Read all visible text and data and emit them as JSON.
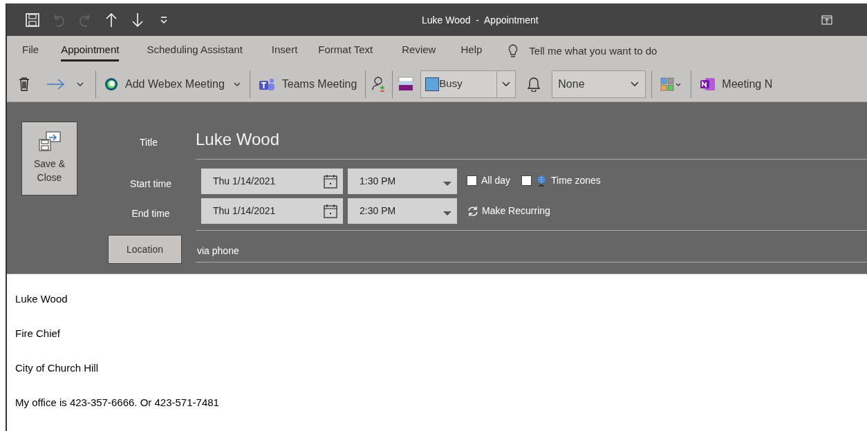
{
  "window": {
    "title": "Luke Wood  -  Appointment"
  },
  "quick_access": [
    {
      "kind": "save",
      "disabled": false
    },
    {
      "kind": "undo",
      "disabled": true
    },
    {
      "kind": "redo",
      "disabled": true
    },
    {
      "kind": "up",
      "disabled": false
    },
    {
      "kind": "down",
      "disabled": false
    },
    {
      "kind": "customize",
      "disabled": false
    }
  ],
  "menu_tabs": [
    {
      "label": "File",
      "selected": false
    },
    {
      "label": "Appointment",
      "selected": true
    },
    {
      "label": "Scheduling Assistant",
      "selected": false
    },
    {
      "label": "Insert",
      "selected": false
    },
    {
      "label": "Format Text",
      "selected": false
    },
    {
      "label": "Review",
      "selected": false
    },
    {
      "label": "Help",
      "selected": false
    }
  ],
  "tell_me": {
    "placeholder": "Tell me what you want to do"
  },
  "toolbar": {
    "webex": "Add Webex Meeting",
    "teams": "Teams Meeting",
    "show_as": {
      "value": "Busy",
      "color": "#5ea4dc"
    },
    "reminder": {
      "value": "None"
    },
    "onenote": "Meeting N"
  },
  "form": {
    "save_close": "Save &\nClose",
    "title_label": "Title",
    "title_value": "Luke Wood",
    "rows": [
      {
        "label": "Start time",
        "date": "Thu 1/14/2021",
        "time": "1:30 PM"
      },
      {
        "label": "End time",
        "date": "Thu 1/14/2021",
        "time": "2:30 PM"
      }
    ],
    "all_day": {
      "label": "All day",
      "checked": false
    },
    "time_zones": {
      "label": "Time zones",
      "checked": false
    },
    "make_recurring": "Make Recurring",
    "location_button": "Location",
    "location_value": "via phone"
  },
  "body": [
    "Luke Wood",
    "Fire Chief",
    "City of Church Hill",
    "My office is 423-357-6666. Or 423-571-7481"
  ]
}
